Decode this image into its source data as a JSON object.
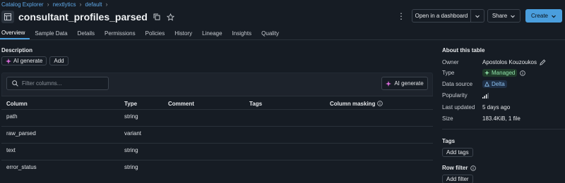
{
  "breadcrumb": {
    "items": [
      "Catalog Explorer",
      "nextlytics",
      "default"
    ]
  },
  "header": {
    "title": "consultant_profiles_parsed",
    "open_dashboard_label": "Open in a dashboard",
    "share_label": "Share",
    "create_label": "Create",
    "accent_color": "#4a9edd"
  },
  "tabs": [
    {
      "label": "Overview",
      "active": true
    },
    {
      "label": "Sample Data"
    },
    {
      "label": "Details"
    },
    {
      "label": "Permissions"
    },
    {
      "label": "Policies"
    },
    {
      "label": "History"
    },
    {
      "label": "Lineage"
    },
    {
      "label": "Insights"
    },
    {
      "label": "Quality"
    }
  ],
  "description": {
    "label": "Description",
    "ai_generate_label": "AI generate",
    "add_label": "Add"
  },
  "columns_panel": {
    "filter_placeholder": "Filter columns...",
    "ai_generate_label": "AI generate",
    "headers": [
      "Column",
      "Type",
      "Comment",
      "Tags",
      "Column masking"
    ],
    "rows": [
      {
        "column": "path",
        "type": "string"
      },
      {
        "column": "raw_parsed",
        "type": "variant"
      },
      {
        "column": "text",
        "type": "string"
      },
      {
        "column": "error_status",
        "type": "string"
      }
    ]
  },
  "about": {
    "title": "About this table",
    "owner_key": "Owner",
    "owner_value": "Apostolos Kouzoukos",
    "type_key": "Type",
    "type_value": "Managed",
    "source_key": "Data source",
    "source_value": "Delta",
    "popularity_key": "Popularity",
    "updated_key": "Last updated",
    "updated_value": "5 days ago",
    "size_key": "Size",
    "size_value": "183.4KiB, 1 file"
  },
  "tags": {
    "title": "Tags",
    "add_label": "Add tags"
  },
  "row_filter": {
    "title": "Row filter",
    "add_label": "Add filter"
  }
}
